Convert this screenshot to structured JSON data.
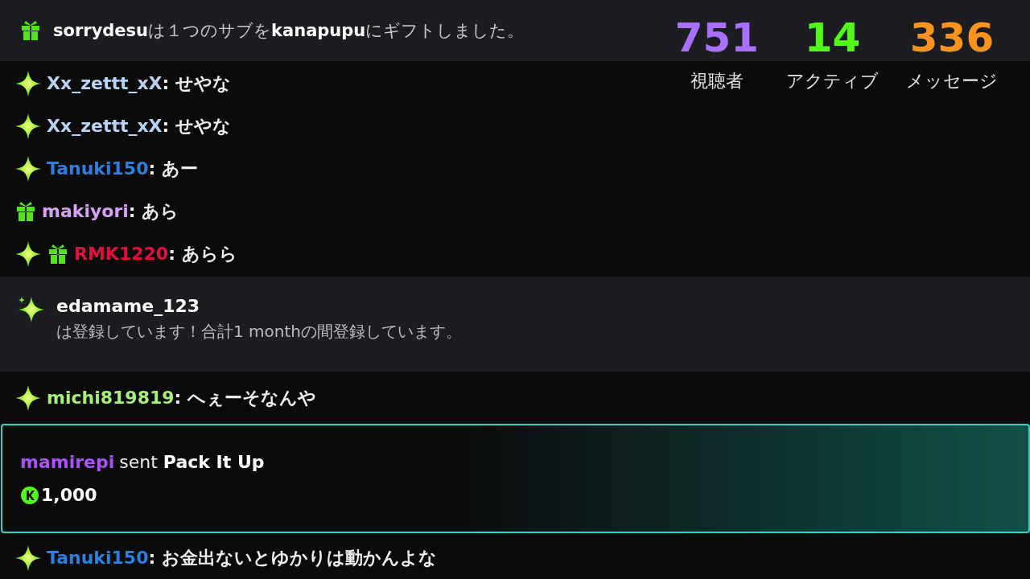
{
  "gift_banner": {
    "text": "**sorrydesu**は１つのサブを**kanapupu**にギフトしました。"
  },
  "stats": [
    {
      "value": "751",
      "label": "視聴者",
      "color": "#a970ff"
    },
    {
      "value": "14",
      "label": "アクティブ",
      "color": "#53fc18"
    },
    {
      "value": "336",
      "label": "メッセージ",
      "color": "#f7931e"
    }
  ],
  "messages": [
    {
      "kind": "chat",
      "badges": [
        {
          "kind": "sub"
        }
      ],
      "user": "Xx_zettt_xX",
      "color": "#b9d3f5",
      "text": ": せやな"
    },
    {
      "kind": "chat",
      "badges": [
        {
          "kind": "sub"
        }
      ],
      "user": "Xx_zettt_xX",
      "color": "#b9d3f5",
      "text": ": せやな"
    },
    {
      "kind": "chat",
      "badges": [
        {
          "kind": "sub"
        }
      ],
      "user": "Tanuki150",
      "color": "#2f7fe0",
      "text": ": あー"
    },
    {
      "kind": "chat",
      "badges": [
        {
          "kind": "gift"
        }
      ],
      "user": "makiyori",
      "color": "#d5a2f5",
      "text": ": あら"
    },
    {
      "kind": "chat",
      "badges": [
        {
          "kind": "sub"
        },
        {
          "kind": "gift"
        }
      ],
      "user": "RMK1220",
      "color": "#e0103f",
      "text": ": あらら"
    },
    {
      "kind": "resub",
      "user": "edamame_123",
      "text": "は登録しています！合計1 monthの間登録しています。"
    },
    {
      "kind": "chat",
      "badges": [
        {
          "kind": "sub"
        }
      ],
      "user": "michi819819",
      "color": "#a8f07c",
      "text": ": へぇーそなんや"
    },
    {
      "kind": "gift",
      "user": "mamirepi",
      "color": "#a855f7",
      "text": "sent **Pack It Up**",
      "amount": "1,000"
    },
    {
      "kind": "chat",
      "badges": [
        {
          "kind": "sub"
        }
      ],
      "user": "Tanuki150",
      "color": "#2f7fe0",
      "text": ": お金出ないとゆかりは動かんよな"
    }
  ]
}
